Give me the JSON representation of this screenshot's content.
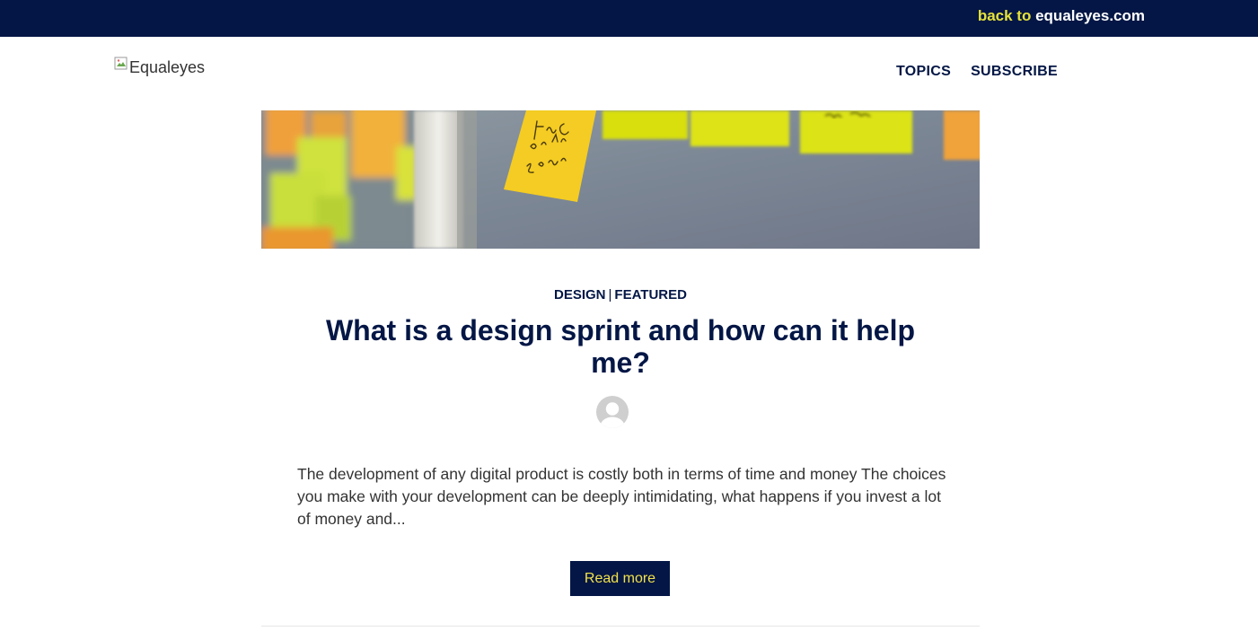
{
  "topbar": {
    "back_prefix": "back to",
    "back_domain": "equaleyes.com",
    "background_color": "#031645",
    "prefix_color": "#e6e23a"
  },
  "header": {
    "logo_alt": "Equaleyes",
    "nav": [
      {
        "label": "TOPICS"
      },
      {
        "label": "SUBSCRIBE"
      }
    ]
  },
  "post": {
    "hero_image": "sticky-notes-board",
    "categories": [
      "DESIGN",
      "FEATURED"
    ],
    "category_separator": "|",
    "title": "What is a design sprint and how can it help me?",
    "author_avatar": "default-user-avatar",
    "excerpt": "The development of any digital product is costly both in terms of time and money The choices you make with your development can be deeply intimidating, what happens if you invest a lot of money and...",
    "read_more_label": "Read more"
  },
  "colors": {
    "brand_navy": "#031645",
    "accent_yellow": "#f2e24a"
  }
}
